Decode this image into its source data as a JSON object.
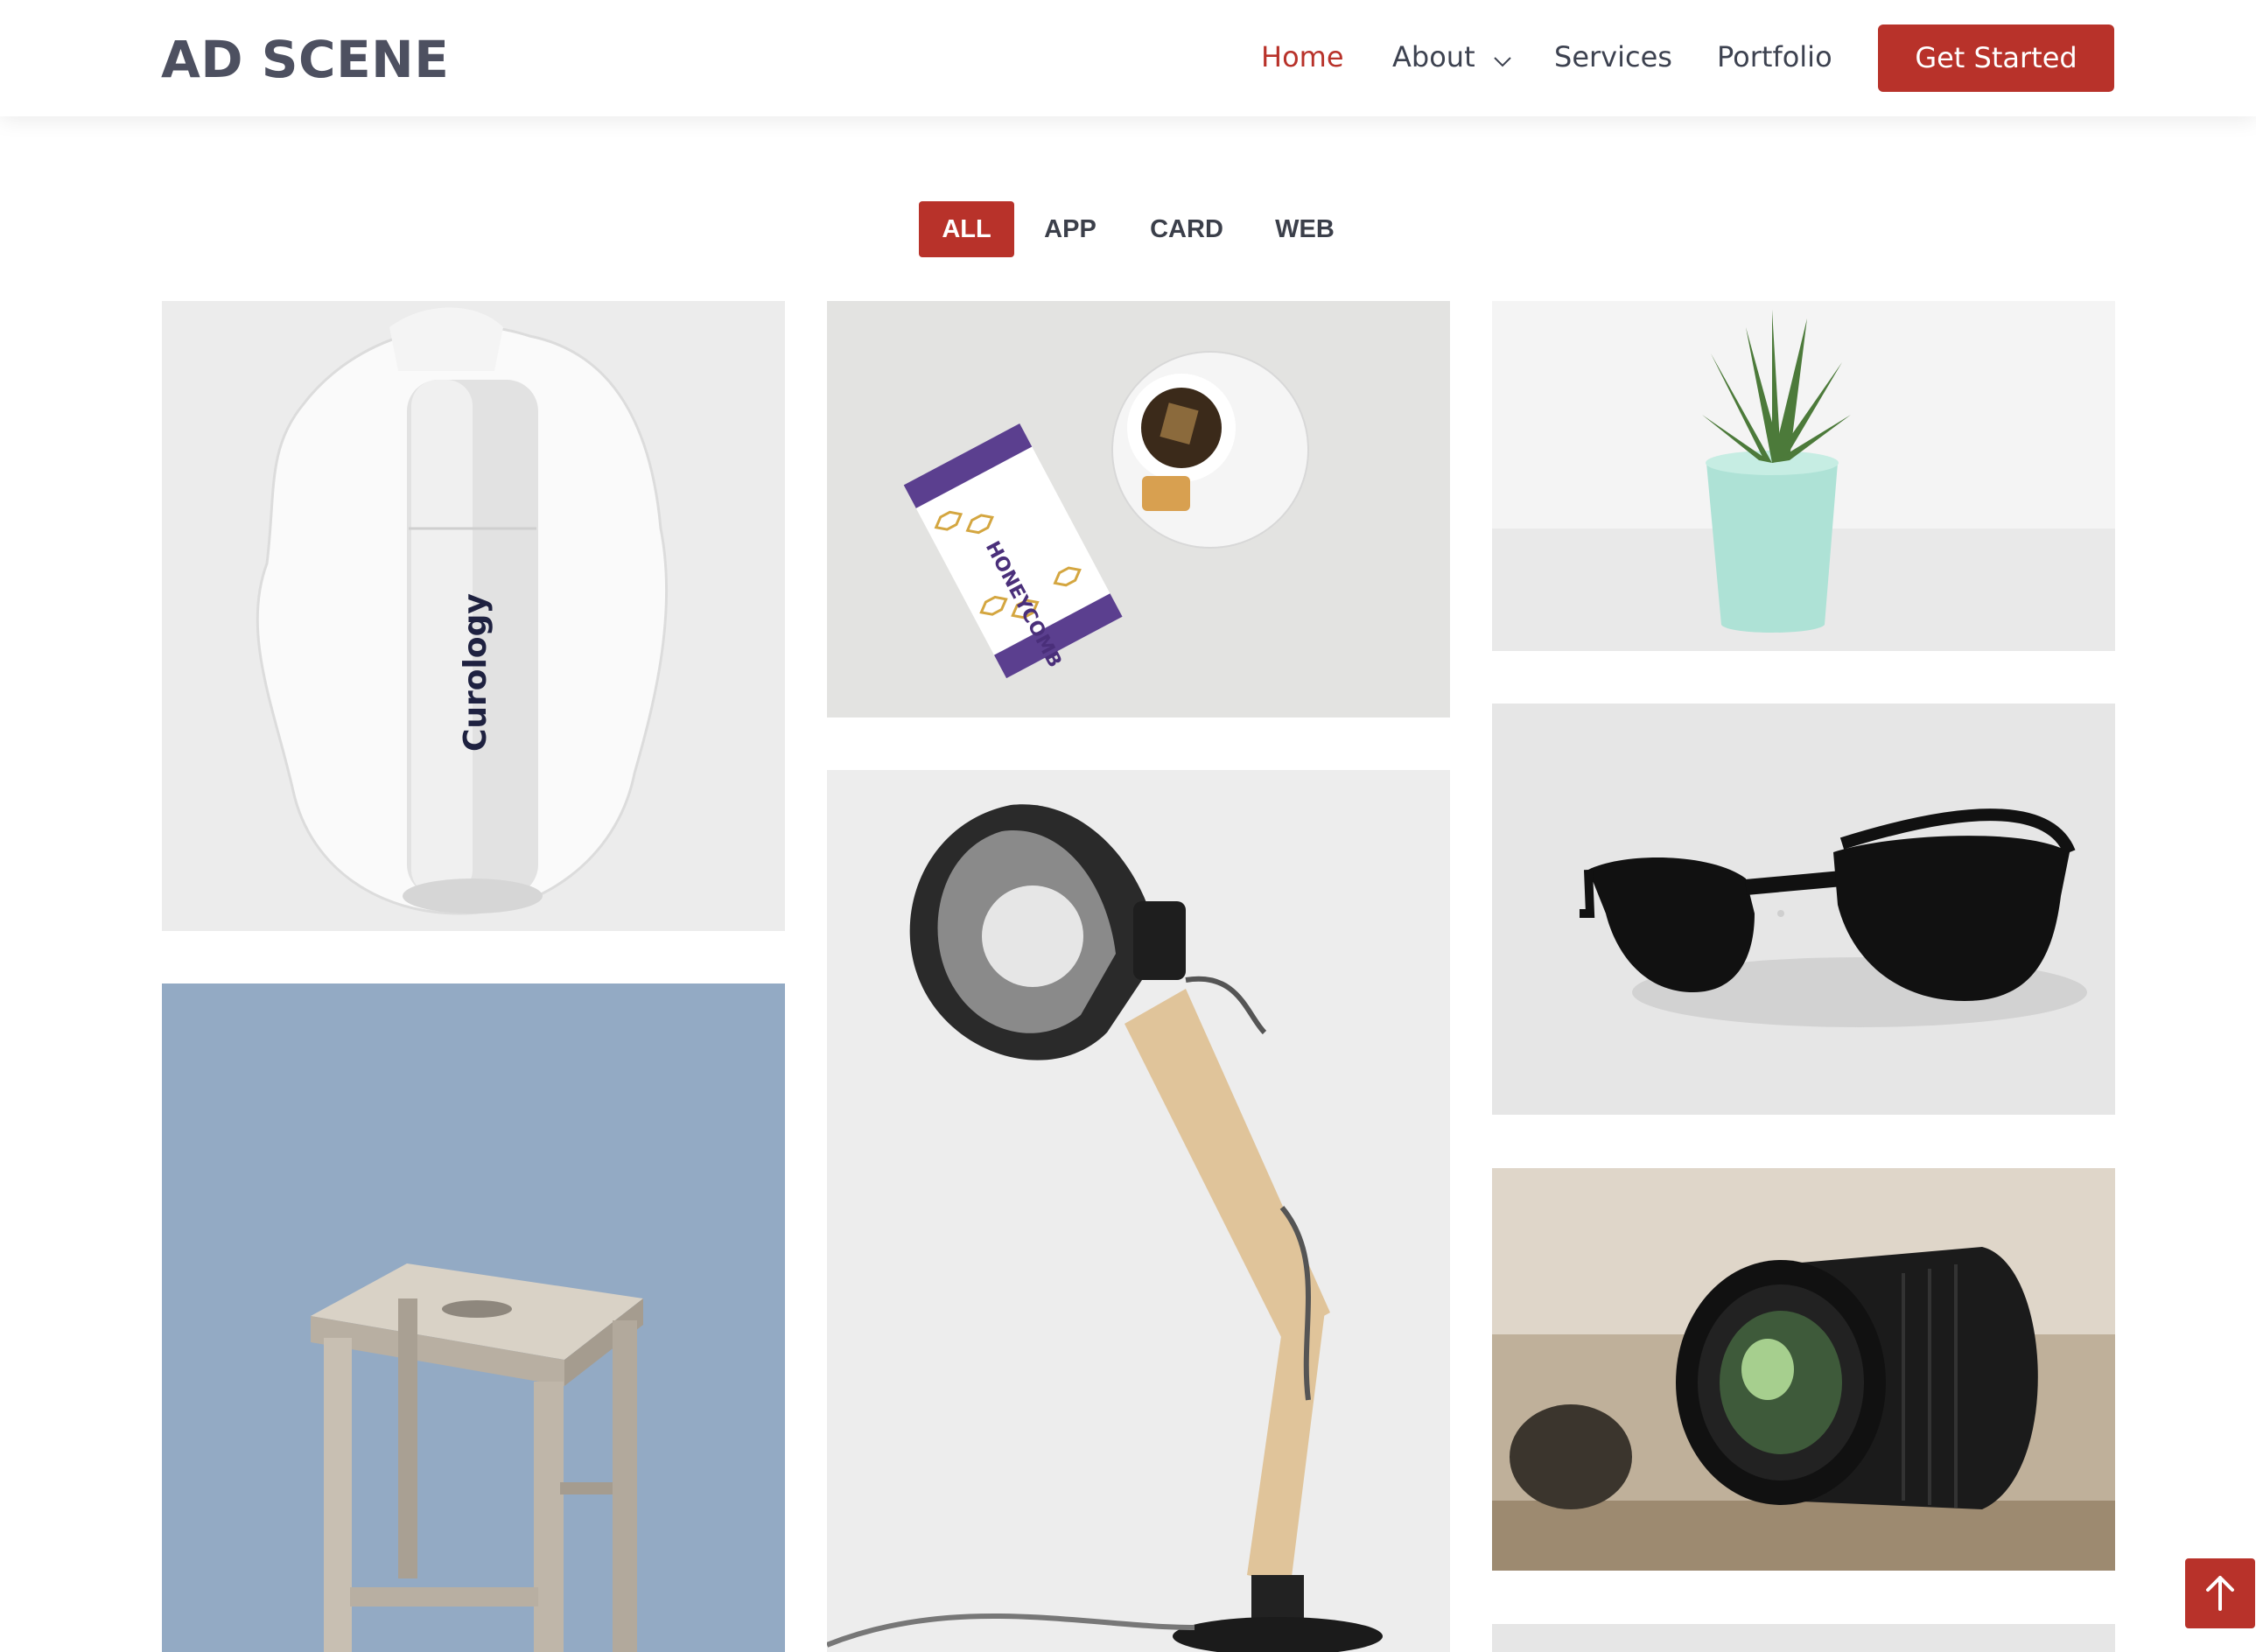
{
  "header": {
    "logo": "AD SCENE",
    "nav": {
      "home": "Home",
      "about": "About",
      "services": "Services",
      "portfolio": "Portfolio"
    },
    "cta": "Get Started"
  },
  "filters": {
    "active": "ALL",
    "items": [
      "ALL",
      "APP",
      "CARD",
      "WEB"
    ]
  },
  "portfolio": {
    "items": [
      {
        "subject": "cosmetic bottle",
        "label": "Curology"
      },
      {
        "subject": "honeycomb tea tube and cup",
        "label": "HONEYCOMB"
      },
      {
        "subject": "succulent in mint pot"
      },
      {
        "subject": "black sunglasses"
      },
      {
        "subject": "wooden desk lamp"
      },
      {
        "subject": "wooden stool on blue"
      },
      {
        "subject": "camera lens"
      },
      {
        "subject": "partial image"
      }
    ]
  },
  "colors": {
    "accent": "#b8322a",
    "nav_text": "#3d4250",
    "logo": "#4d5060"
  },
  "icons": {
    "about_chevron": "chevron-down-icon",
    "back_to_top": "arrow-up-icon"
  }
}
